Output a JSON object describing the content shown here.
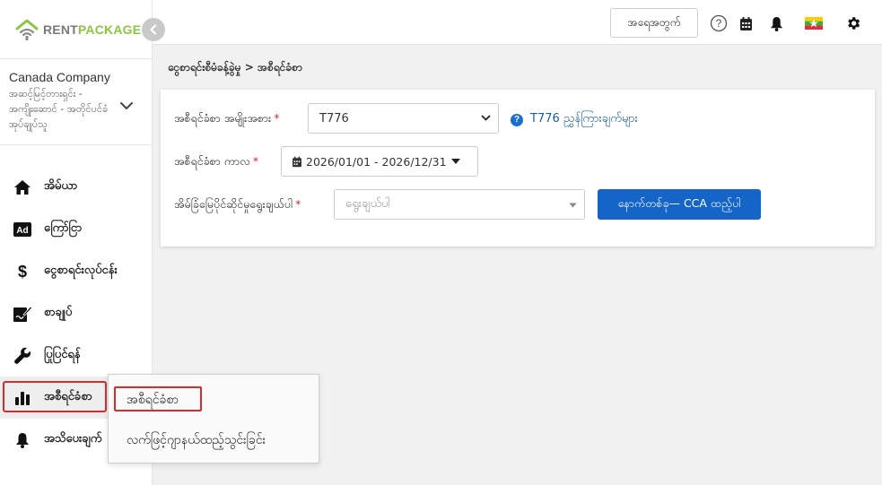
{
  "brand": {
    "part1": "RENT",
    "part2": "PACKAGE"
  },
  "company": {
    "name": "Canada Company",
    "role": "အဆင့်မြင့်တားရှင်း - အကျိုးဆောင် - အတိုင်ပင်ခံအုပ်ချုပ်သူ"
  },
  "sidebar": {
    "items": [
      {
        "label": "အိမ်ယာ",
        "icon": "home-icon"
      },
      {
        "label": "ကြော်ငြာ",
        "icon": "ad-icon"
      },
      {
        "label": "ငွေစာရင်းလုပ်ငန်း",
        "icon": "dollar-icon"
      },
      {
        "label": "စာချုပ်",
        "icon": "contract-icon"
      },
      {
        "label": "ပြုပြင်ရန်",
        "icon": "wrench-icon"
      },
      {
        "label": "အစီရင်ခံစာ",
        "icon": "bar-chart-icon"
      },
      {
        "label": "အသိပေးချက်",
        "icon": "bell-icon"
      }
    ]
  },
  "topbar": {
    "logout_label": "အရေအတွက်"
  },
  "breadcrumb": "ငွေစာရင်းစီမံခန့်ခွဲမှု > အစီရင်ခံစာ",
  "form": {
    "report_type_label": "အစီရင်ခံစာ အမျိုးအစား",
    "report_type_value": "T776",
    "help_link": "T776 ညွှန်ကြားချက်များ",
    "period_label": "အစီရင်ခံစာ ကာလ",
    "period_value": "2026/01/01 - 2026/12/31",
    "property_label": "အိမ်ခြံမြေပိုင်ဆိုင်မှုရွေးချယ်ပါ",
    "property_placeholder": "ရွေးချယ်ပါ",
    "next_button": "နောက်တစ်ခု— CCA ထည့်ပါ"
  },
  "popover": {
    "items": [
      "အစီရင်ခံစာ",
      "လက်ဖြင့်ဂျာနယ်ထည့်သွင်းခြင်း"
    ]
  },
  "colors": {
    "primary": "#1565c8",
    "brand_green": "#8cc63f",
    "highlight_red": "#d32f2f",
    "required_red": "#d32f2f"
  }
}
